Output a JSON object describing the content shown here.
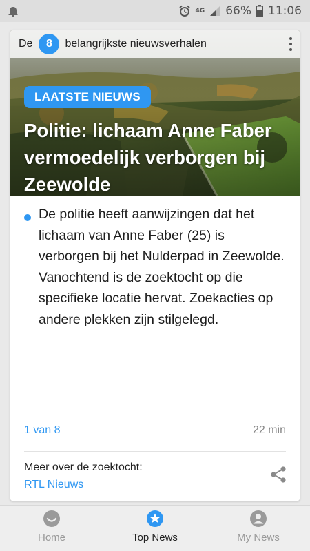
{
  "status_bar": {
    "network": "4G",
    "battery": "66%",
    "time": "11:06",
    "icons": [
      "notification-bell-icon",
      "alarm-icon",
      "signal-icon",
      "battery-icon"
    ]
  },
  "card": {
    "topline": {
      "prefix": "De",
      "count": "8",
      "suffix": "belangrijkste nieuwsverhalen"
    },
    "badge": "LAATSTE NIEUWS",
    "headline": "Politie: lichaam Anne Faber vermoedelijk verborgen bij Zeewolde",
    "body": "De politie heeft aanwijzingen dat het lichaam van Anne Faber (25) is verborgen bij het Nulderpad in Zeewolde. Vanochtend is de zoektocht op die specifieke locatie hervat. Zoekacties op andere plekken zijn stilgelegd.",
    "position": "1 van 8",
    "age": "22 min",
    "more_label": "Meer over de zoektocht:",
    "more_link": "RTL Nieuws"
  },
  "nav": {
    "tabs": [
      {
        "label": "Home",
        "icon": "smiley-icon",
        "active": false
      },
      {
        "label": "Top News",
        "icon": "star-icon",
        "active": true
      },
      {
        "label": "My News",
        "icon": "person-icon",
        "active": false
      }
    ]
  },
  "colors": {
    "accent": "#2f97f2",
    "background": "#e9e9e9",
    "card": "#ffffff"
  }
}
